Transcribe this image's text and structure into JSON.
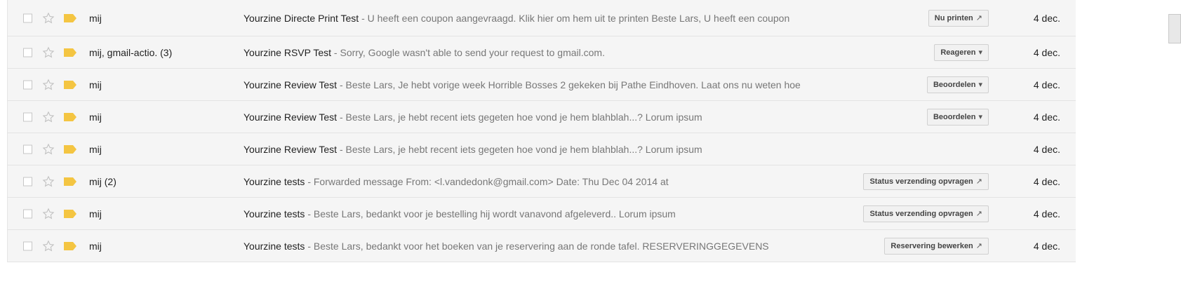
{
  "emails": [
    {
      "sender": "mij",
      "subject": "Yourzine Directe Print Test",
      "snippet": " - U heeft een coupon aangevraagd. Klik hier om hem uit te printen Beste Lars, U heeft een coupon",
      "action": "Nu printen",
      "action_symbol": "↗",
      "date": "4 dec."
    },
    {
      "sender": "mij, gmail-actio. (3)",
      "subject": "Yourzine RSVP Test",
      "snippet": " - Sorry, Google wasn't able to send your request to gmail.com.",
      "action": "Reageren",
      "action_symbol": "▾",
      "date": "4 dec."
    },
    {
      "sender": "mij",
      "subject": "Yourzine Review Test",
      "snippet": " - Beste Lars, Je hebt vorige week Horrible Bosses 2 gekeken bij Pathe Eindhoven. Laat ons nu weten hoe",
      "action": "Beoordelen",
      "action_symbol": "▾",
      "date": "4 dec."
    },
    {
      "sender": "mij",
      "subject": "Yourzine Review Test",
      "snippet": " - Beste Lars, je hebt recent iets gegeten hoe vond je hem blahblah...? Lorum ipsum",
      "action": "Beoordelen",
      "action_symbol": "▾",
      "date": "4 dec."
    },
    {
      "sender": "mij",
      "subject": "Yourzine Review Test",
      "snippet": " - Beste Lars, je hebt recent iets gegeten hoe vond je hem blahblah...? Lorum ipsum",
      "action": "",
      "action_symbol": "",
      "date": "4 dec."
    },
    {
      "sender": "mij (2)",
      "subject": "Yourzine tests",
      "snippet": " -  Forwarded message From: <l.vandedonk@gmail.com> Date: Thu Dec 04 2014 at",
      "action": "Status verzending opvragen",
      "action_symbol": "↗",
      "date": "4 dec."
    },
    {
      "sender": "mij",
      "subject": "Yourzine tests",
      "snippet": " - Beste Lars, bedankt voor je bestelling hij wordt vanavond afgeleverd.. Lorum ipsum",
      "action": "Status verzending opvragen",
      "action_symbol": "↗",
      "date": "4 dec."
    },
    {
      "sender": "mij",
      "subject": "Yourzine tests",
      "snippet": " - Beste Lars, bedankt voor het boeken van je reservering aan de ronde tafel. RESERVERINGGEGEVENS",
      "action": "Reservering bewerken",
      "action_symbol": "↗",
      "date": "4 dec."
    }
  ],
  "colors": {
    "row_background": "#f5f5f5",
    "important_tag": "#f4c542",
    "star_outline": "#c0c0c0"
  },
  "icons": {
    "checkbox": "checkbox-icon",
    "star": "star-icon",
    "tag": "importance-marker-icon"
  }
}
